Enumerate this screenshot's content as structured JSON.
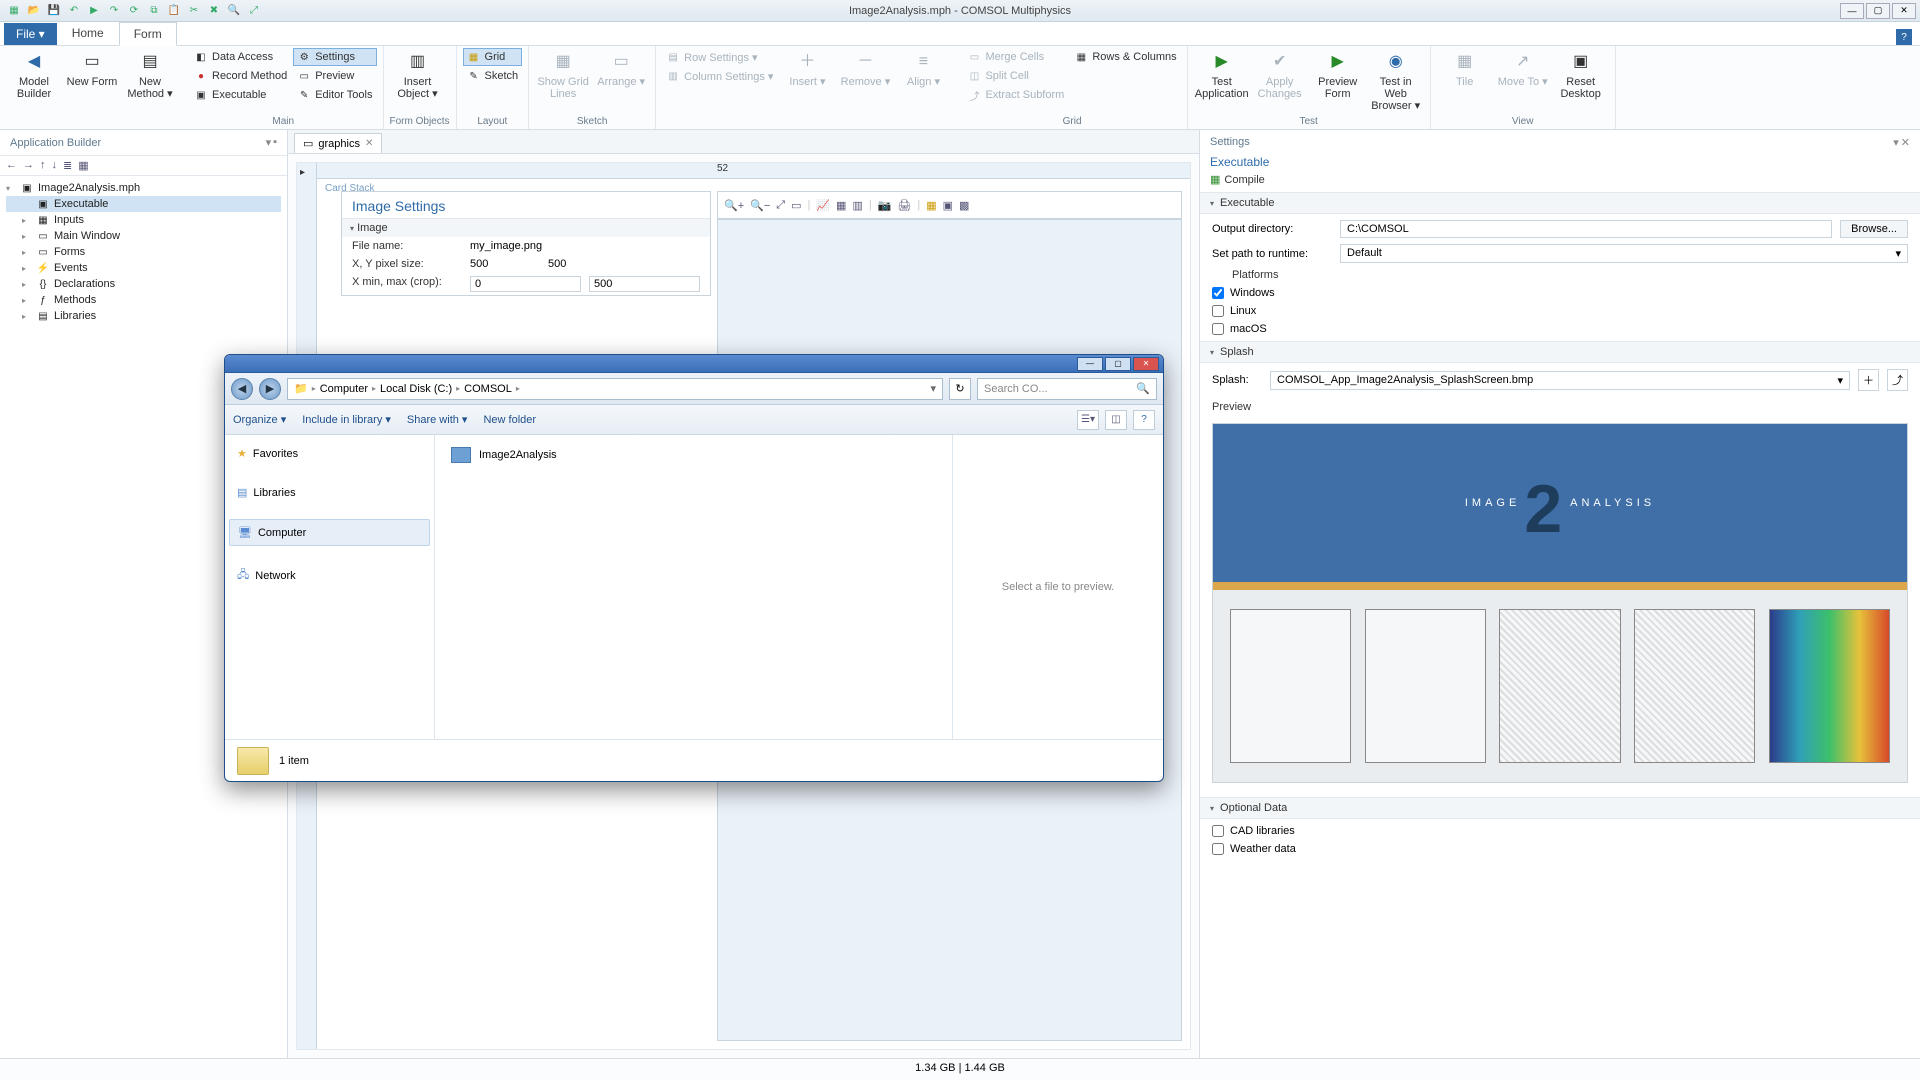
{
  "app": {
    "title": "Image2Analysis.mph - COMSOL Multiphysics"
  },
  "menubar": {
    "file": "File ▾",
    "tabs": [
      "Home",
      "Form"
    ],
    "active": 1
  },
  "ribbon": {
    "groups": {
      "builder": {
        "model_builder": "Model Builder",
        "new_form": "New Form",
        "new_method": "New Method ▾"
      },
      "main": {
        "label": "Main",
        "data_access": "Data Access",
        "record_method": "Record Method",
        "executable": "Executable",
        "settings": "Settings",
        "preview": "Preview",
        "editor_tools": "Editor Tools"
      },
      "form_objects": {
        "label": "Form Objects",
        "insert_object": "Insert Object ▾"
      },
      "layout": {
        "label": "Layout",
        "grid": "Grid",
        "sketch": "Sketch"
      },
      "sketch": {
        "label": "Sketch",
        "show_grid": "Show Grid Lines",
        "arrange": "Arrange ▾"
      },
      "row_col": {
        "row_settings": "Row Settings ▾",
        "column_settings": "Column Settings ▾",
        "insert": "Insert ▾",
        "remove": "Remove ▾",
        "align": "Align ▾"
      },
      "grid": {
        "label": "Grid",
        "merge_cells": "Merge Cells",
        "split_cell": "Split Cell",
        "extract_subform": "Extract Subform",
        "rows_columns": "Rows & Columns"
      },
      "test": {
        "label": "Test",
        "test_application": "Test Application",
        "apply_changes": "Apply Changes",
        "preview_form": "Preview Form",
        "test_in_web": "Test in Web Browser ▾"
      },
      "view": {
        "label": "View",
        "tile": "Tile",
        "move_to": "Move To ▾",
        "reset_desktop": "Reset Desktop"
      }
    }
  },
  "app_builder": {
    "title": "Application Builder",
    "root": "Image2Analysis.mph",
    "nodes": [
      "Executable",
      "Inputs",
      "Main Window",
      "Forms",
      "Events",
      "Declarations",
      "Methods",
      "Libraries"
    ]
  },
  "graphics": {
    "tab_label": "graphics",
    "card_stack": "Card Stack",
    "form_title": "Image Settings",
    "section": "Image",
    "rows": {
      "file_name": {
        "label": "File name:",
        "value": "my_image.png"
      },
      "pixel_size": {
        "label": "X, Y pixel size:",
        "x": "500",
        "y": "500"
      },
      "crop": {
        "label": "X min, max (crop):",
        "min": "0",
        "max": "500"
      }
    },
    "ruler_mark": "52"
  },
  "settings": {
    "title": "Settings",
    "subtitle": "Executable",
    "compile": "Compile",
    "executable": {
      "header": "Executable",
      "output_dir_label": "Output directory:",
      "output_dir": "C:\\COMSOL",
      "browse": "Browse...",
      "runtime_label": "Set path to runtime:",
      "runtime": "Default",
      "platforms_label": "Platforms",
      "windows": "Windows",
      "linux": "Linux",
      "macos": "macOS"
    },
    "splash": {
      "header": "Splash",
      "label": "Splash:",
      "file": "COMSOL_App_Image2Analysis_SplashScreen.bmp",
      "preview": "Preview",
      "img_text1": "IMAGE",
      "img_text2": "2",
      "img_text3": "ANALYSIS"
    },
    "optional": {
      "header": "Optional Data",
      "cad": "CAD libraries",
      "weather": "Weather data"
    }
  },
  "explorer": {
    "crumbs": [
      "Computer",
      "Local Disk (C:)",
      "COMSOL"
    ],
    "search_placeholder": "Search CO...",
    "cmds": {
      "organize": "Organize ▾",
      "include": "Include in library ▾",
      "share": "Share with ▾",
      "new_folder": "New folder"
    },
    "nav": {
      "favorites": "Favorites",
      "libraries": "Libraries",
      "computer": "Computer",
      "network": "Network"
    },
    "file": "Image2Analysis",
    "preview": "Select a file to preview.",
    "status": "1 item"
  },
  "statusbar": {
    "memory": "1.34 GB | 1.44 GB"
  }
}
